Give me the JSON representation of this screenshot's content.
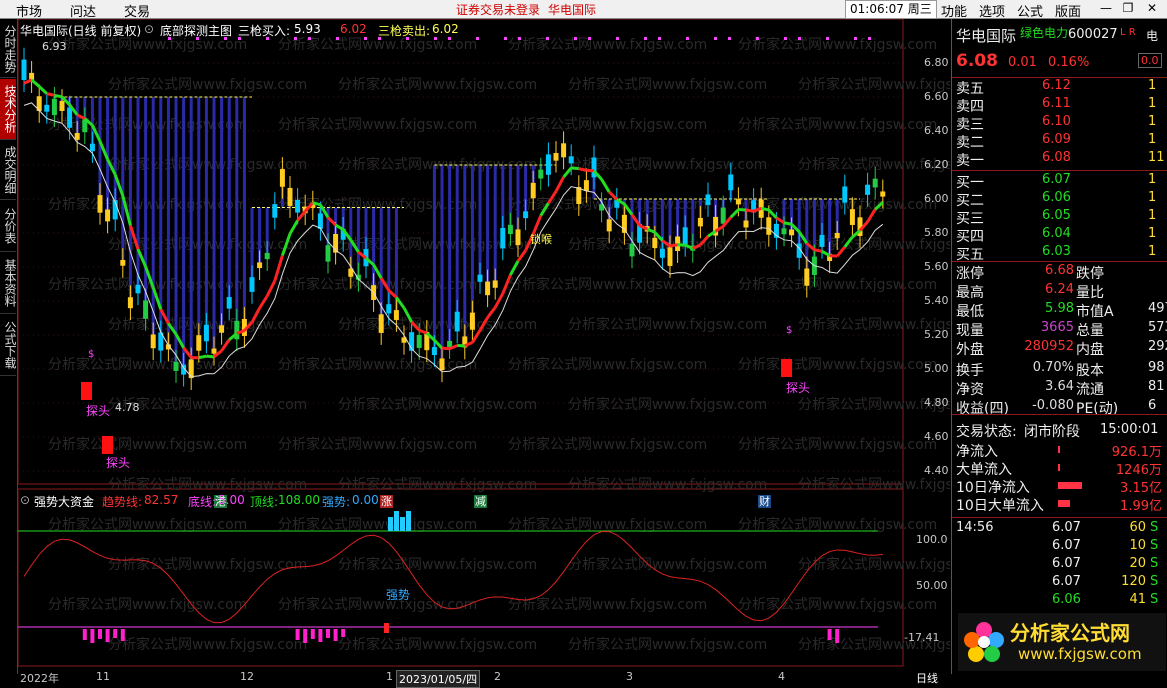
{
  "topbar": {
    "menus": [
      "市场",
      "问达",
      "交易"
    ],
    "warning": "证券交易未登录",
    "stock": "华电国际",
    "clock": "01:06:07 周三",
    "right_menus": [
      "功能",
      "选项",
      "公式",
      "版面"
    ]
  },
  "left_tabs": [
    "分时走势",
    "技术分析",
    "成交明细",
    "分价表",
    "基本资料",
    "公式下载"
  ],
  "main_header": {
    "title": "华电国际(日线 前复权)",
    "indicator": "底部探测主图",
    "buy_label": "三枪买入:",
    "buy_value": "5.93",
    "buy_value2": "6.02",
    "sell_label": "三枪卖出:",
    "sell_value": "6.02"
  },
  "price_axis": [
    "6.80",
    "6.60",
    "6.40",
    "6.20",
    "6.00",
    "5.80",
    "5.60",
    "5.40",
    "5.20",
    "5.00",
    "4.80",
    "4.60",
    "4.40"
  ],
  "annotations": {
    "high_price": "6.93",
    "low_price": "4.78",
    "bottom_label": "探头",
    "lock_label": "锁喉",
    "dollar": "$"
  },
  "events": [
    "港",
    "涨",
    "减",
    "财"
  ],
  "sub_header": {
    "title": "强势大资金",
    "trend_label": "趋势线:",
    "trend_value": "82.57",
    "bottom_label": "底线:",
    "bottom_value": "5.00",
    "top_label": "顶线:",
    "top_value": "108.00",
    "strong_label": "强势:",
    "strong_value": "0.00",
    "strong_tag": "强势"
  },
  "sub_axis": [
    "100.0",
    "50.00",
    "-17.41"
  ],
  "x_axis": [
    "2022年",
    "11",
    "12",
    "1",
    "2023/01/05/四",
    "2",
    "3",
    "4"
  ],
  "period": "日线",
  "quote": {
    "name": "华电国际",
    "tag": "绿色电力",
    "code": "600027",
    "lr": "L R",
    "price": "6.08",
    "change": "0.01",
    "pct": "0.16%",
    "side_label": "电",
    "side_value": "0.0"
  },
  "order_book": [
    {
      "label": "卖五",
      "price": "6.12",
      "vol": "1"
    },
    {
      "label": "卖四",
      "price": "6.11",
      "vol": "1"
    },
    {
      "label": "卖三",
      "price": "6.10",
      "vol": "1"
    },
    {
      "label": "卖二",
      "price": "6.09",
      "vol": "1"
    },
    {
      "label": "卖一",
      "price": "6.08",
      "vol": "11"
    },
    {
      "label": "买一",
      "price": "6.07",
      "vol": "1"
    },
    {
      "label": "买二",
      "price": "6.06",
      "vol": "1"
    },
    {
      "label": "买三",
      "price": "6.05",
      "vol": "1"
    },
    {
      "label": "买四",
      "price": "6.04",
      "vol": "1"
    },
    {
      "label": "买五",
      "price": "6.03",
      "vol": "1"
    }
  ],
  "stats": [
    {
      "l1": "涨停",
      "v1": "6.68",
      "c1": "#ff3333",
      "l2": "跌停",
      "v2": ""
    },
    {
      "l1": "最高",
      "v1": "6.24",
      "c1": "#ff3333",
      "l2": "量比",
      "v2": ""
    },
    {
      "l1": "最低",
      "v1": "5.98",
      "c1": "#22dd22",
      "l2": "市值A",
      "v2": "497"
    },
    {
      "l1": "现量",
      "v1": "3665",
      "c1": "#cc44cc",
      "l2": "总量",
      "v2": "573"
    },
    {
      "l1": "外盘",
      "v1": "280952",
      "c1": "#ff3333",
      "l2": "内盘",
      "v2": "292"
    },
    {
      "l1": "换手",
      "v1": "0.70%",
      "c1": "#dddddd",
      "l2": "股本",
      "v2": "98"
    },
    {
      "l1": "净资",
      "v1": "3.64",
      "c1": "#dddddd",
      "l2": "流通",
      "v2": "81"
    },
    {
      "l1": "收益(四)",
      "v1": "-0.080",
      "c1": "#dddddd",
      "l2": "PE(动)",
      "v2": "6"
    }
  ],
  "trade_status": {
    "label": "交易状态:",
    "value": "闭市阶段",
    "time": "15:00:01"
  },
  "flows": [
    {
      "label": "净流入",
      "value": "926.1万"
    },
    {
      "label": "大单流入",
      "value": "1246万"
    },
    {
      "label": "10日净流入",
      "value": "3.15亿"
    },
    {
      "label": "10日大单流入",
      "value": "1.99亿"
    }
  ],
  "ticks": [
    {
      "time": "14:56",
      "price": "6.07",
      "vol": "60",
      "side": "S"
    },
    {
      "time": "",
      "price": "6.07",
      "vol": "10",
      "side": "S"
    },
    {
      "time": "",
      "price": "6.07",
      "vol": "20",
      "side": "S"
    },
    {
      "time": "",
      "price": "6.07",
      "vol": "120",
      "side": "S"
    },
    {
      "time": "",
      "price": "6.06",
      "vol": "41",
      "side": "S"
    }
  ],
  "logo": {
    "title": "分析家公式网",
    "url": "www.fxjgsw.com"
  },
  "watermark": "分析家公式网www.fxjgsw.com",
  "colors": {
    "up": "#ff3333",
    "down": "#00ccff",
    "ma_green": "#22dd22",
    "accent": "#ff00ff"
  }
}
